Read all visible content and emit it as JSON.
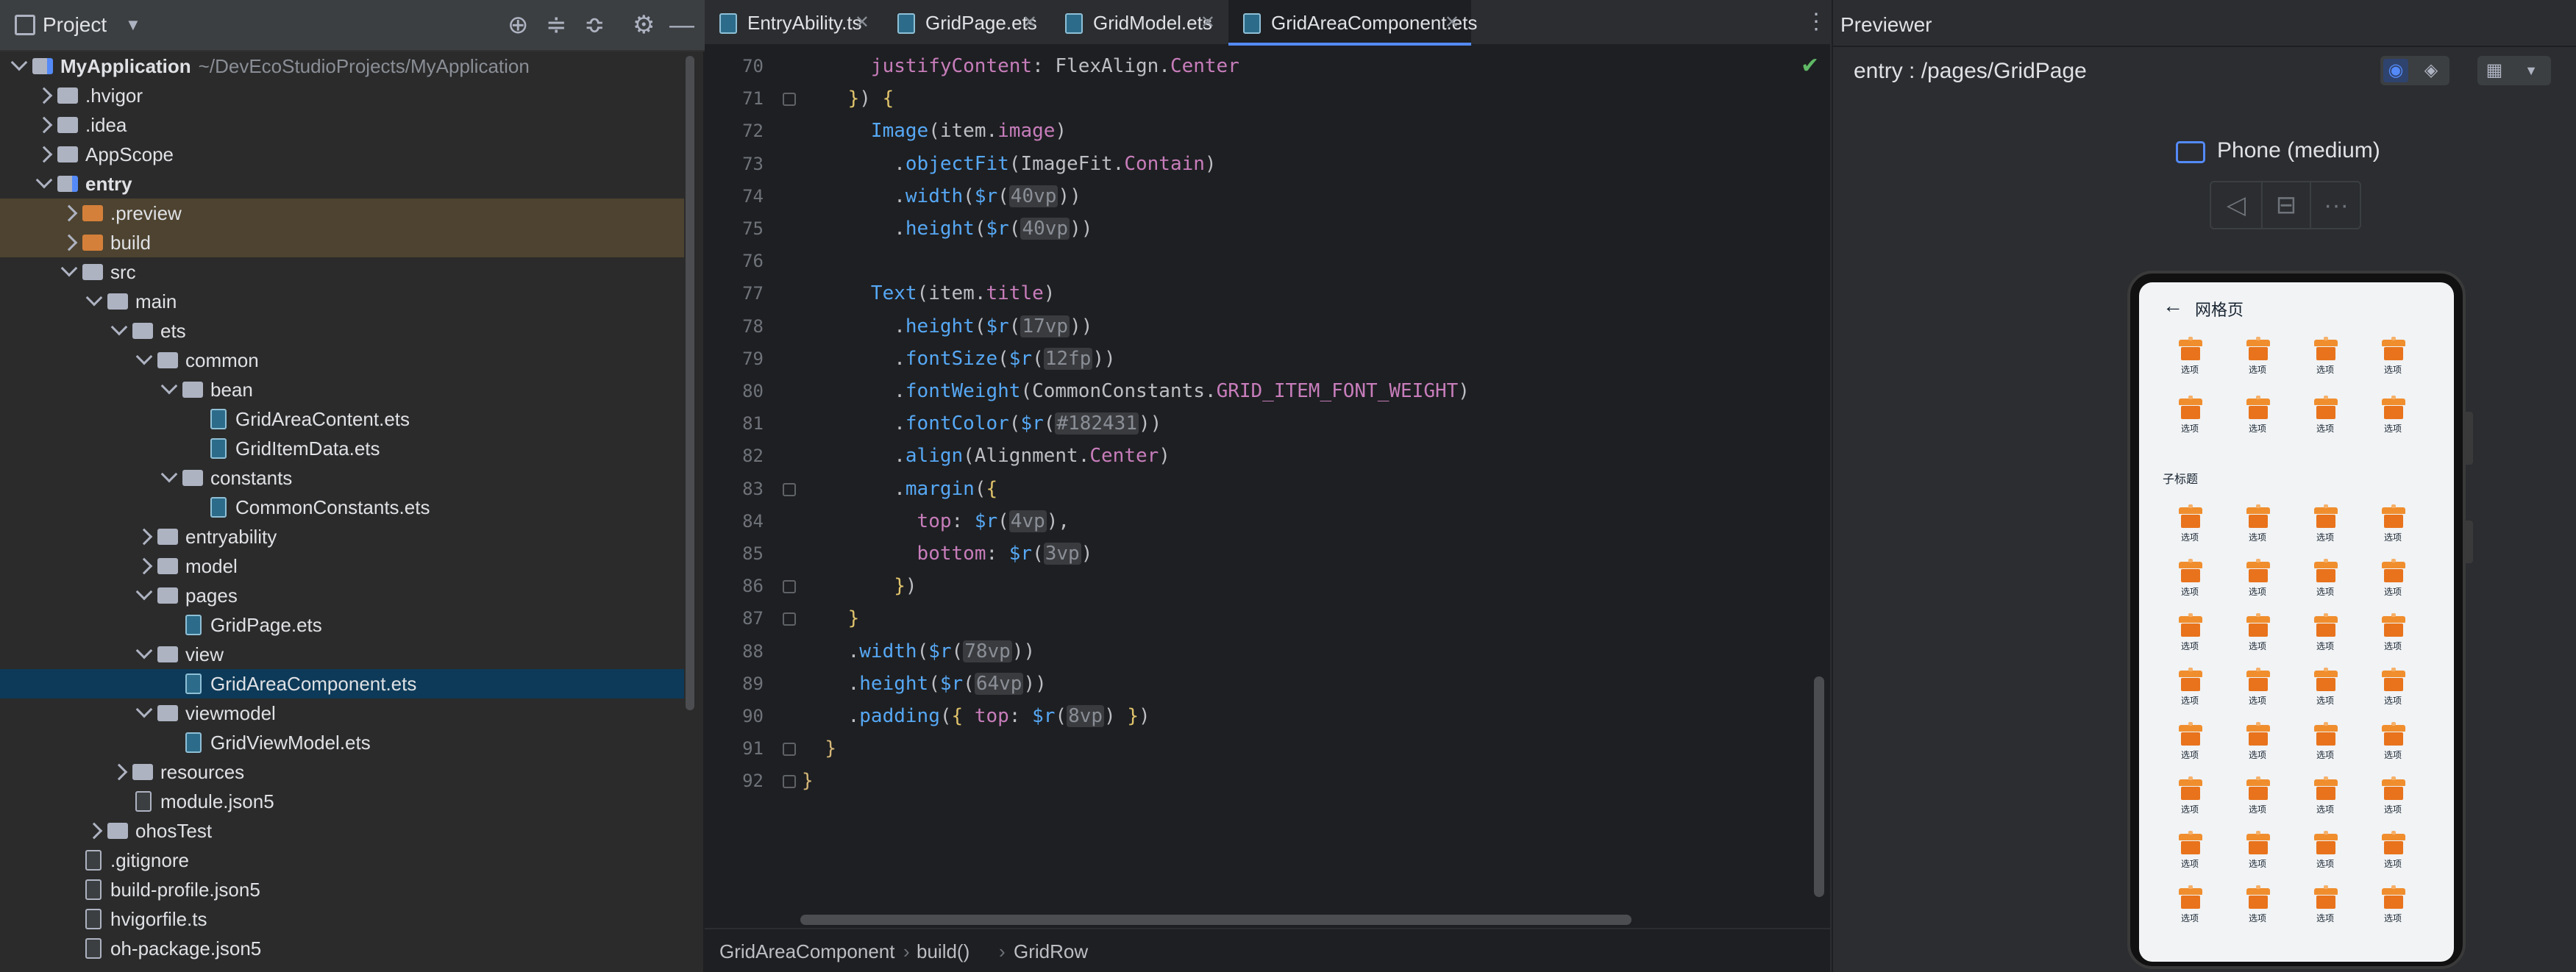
{
  "project_pane": {
    "title": "Project",
    "icons": [
      "dropdown-icon",
      "locate-icon",
      "expand-all-icon",
      "collapse-all-icon",
      "settings-icon",
      "hide-icon"
    ],
    "tree": [
      {
        "label": "MyApplication",
        "path": "~/DevEcoStudioProjects/MyApplication",
        "depth": 0,
        "state": "open",
        "icon": "module",
        "bold": true
      },
      {
        "label": ".hvigor",
        "depth": 1,
        "state": "closed",
        "icon": "folder"
      },
      {
        "label": ".idea",
        "depth": 1,
        "state": "closed",
        "icon": "folder"
      },
      {
        "label": "AppScope",
        "depth": 1,
        "state": "closed",
        "icon": "folder"
      },
      {
        "label": "entry",
        "depth": 1,
        "state": "open",
        "icon": "module",
        "bold": true
      },
      {
        "label": ".preview",
        "depth": 2,
        "state": "closed",
        "icon": "orange",
        "excluded": true
      },
      {
        "label": "build",
        "depth": 2,
        "state": "closed",
        "icon": "orange",
        "excluded": true
      },
      {
        "label": "src",
        "depth": 2,
        "state": "open",
        "icon": "folder"
      },
      {
        "label": "main",
        "depth": 3,
        "state": "open",
        "icon": "folder"
      },
      {
        "label": "ets",
        "depth": 4,
        "state": "open",
        "icon": "folder"
      },
      {
        "label": "common",
        "depth": 5,
        "state": "open",
        "icon": "folder"
      },
      {
        "label": "bean",
        "depth": 6,
        "state": "open",
        "icon": "folder"
      },
      {
        "label": "GridAreaContent.ets",
        "depth": 7,
        "state": "none",
        "icon": "ets"
      },
      {
        "label": "GridItemData.ets",
        "depth": 7,
        "state": "none",
        "icon": "ets"
      },
      {
        "label": "constants",
        "depth": 6,
        "state": "open",
        "icon": "folder"
      },
      {
        "label": "CommonConstants.ets",
        "depth": 7,
        "state": "none",
        "icon": "ets"
      },
      {
        "label": "entryability",
        "depth": 5,
        "state": "closed",
        "icon": "folder"
      },
      {
        "label": "model",
        "depth": 5,
        "state": "closed",
        "icon": "folder"
      },
      {
        "label": "pages",
        "depth": 5,
        "state": "open",
        "icon": "folder"
      },
      {
        "label": "GridPage.ets",
        "depth": 6,
        "state": "none",
        "icon": "ets"
      },
      {
        "label": "view",
        "depth": 5,
        "state": "open",
        "icon": "folder"
      },
      {
        "label": "GridAreaComponent.ets",
        "depth": 6,
        "state": "none",
        "icon": "ets",
        "selected": true
      },
      {
        "label": "viewmodel",
        "depth": 5,
        "state": "open",
        "icon": "folder"
      },
      {
        "label": "GridViewModel.ets",
        "depth": 6,
        "state": "none",
        "icon": "ets"
      },
      {
        "label": "resources",
        "depth": 4,
        "state": "closed",
        "icon": "folder"
      },
      {
        "label": "module.json5",
        "depth": 4,
        "state": "none",
        "icon": "file"
      },
      {
        "label": "ohosTest",
        "depth": 3,
        "state": "closed",
        "icon": "folder"
      },
      {
        "label": ".gitignore",
        "depth": 2,
        "state": "none",
        "icon": "file"
      },
      {
        "label": "build-profile.json5",
        "depth": 2,
        "state": "none",
        "icon": "file"
      },
      {
        "label": "hvigorfile.ts",
        "depth": 2,
        "state": "none",
        "icon": "file"
      },
      {
        "label": "oh-package.json5",
        "depth": 2,
        "state": "none",
        "icon": "file"
      }
    ]
  },
  "editor": {
    "tabs": [
      {
        "label": "EntryAbility.ts",
        "active": false
      },
      {
        "label": "GridPage.ets",
        "active": false
      },
      {
        "label": "GridModel.ets",
        "active": false
      },
      {
        "label": "GridAreaComponent.ets",
        "active": true
      }
    ],
    "lines": [
      {
        "n": "70",
        "fold": false,
        "html": "      <span class='prop'>justifyContent</span>: <span class='type'>FlexAlign</span>.<span class='prop'>Center</span>"
      },
      {
        "n": "71",
        "fold": true,
        "html": "    <span class='br'>}</span>) <span class='br'>{</span>"
      },
      {
        "n": "72",
        "fold": false,
        "html": "      <span class='fn'>Image</span>(<span class='id'>item</span>.<span class='prop'>image</span>)"
      },
      {
        "n": "73",
        "fold": false,
        "html": "        .<span class='fn'>objectFit</span>(<span class='type'>ImageFit</span>.<span class='prop'>Contain</span>)"
      },
      {
        "n": "74",
        "fold": false,
        "html": "        .<span class='fn'>width</span>(<span class='fn'>$r</span>(<span class='num'>40vp</span>))"
      },
      {
        "n": "75",
        "fold": false,
        "html": "        .<span class='fn'>height</span>(<span class='fn'>$r</span>(<span class='num'>40vp</span>))"
      },
      {
        "n": "76",
        "fold": false,
        "html": ""
      },
      {
        "n": "77",
        "fold": false,
        "html": "      <span class='fn'>Text</span>(<span class='id'>item</span>.<span class='prop'>title</span>)"
      },
      {
        "n": "78",
        "fold": false,
        "html": "        .<span class='fn'>height</span>(<span class='fn'>$r</span>(<span class='num'>17vp</span>))"
      },
      {
        "n": "79",
        "fold": false,
        "html": "        .<span class='fn'>fontSize</span>(<span class='fn'>$r</span>(<span class='num'>12fp</span>))"
      },
      {
        "n": "80",
        "fold": false,
        "html": "        .<span class='fn'>fontWeight</span>(<span class='type'>CommonConstants</span>.<span class='prop'>GRID_ITEM_FONT_WEIGHT</span>)"
      },
      {
        "n": "81",
        "fold": false,
        "html": "        .<span class='fn'>fontColor</span>(<span class='fn'>$r</span>(<span class='num'>#182431</span>))"
      },
      {
        "n": "82",
        "fold": false,
        "html": "        .<span class='fn'>align</span>(<span class='type'>Alignment</span>.<span class='prop'>Center</span>)"
      },
      {
        "n": "83",
        "fold": true,
        "html": "        .<span class='fn'>margin</span>(<span class='br'>{</span>"
      },
      {
        "n": "84",
        "fold": false,
        "html": "          <span class='prop'>top</span>: <span class='fn'>$r</span>(<span class='num'>4vp</span>),"
      },
      {
        "n": "85",
        "fold": false,
        "html": "          <span class='prop'>bottom</span>: <span class='fn'>$r</span>(<span class='num'>3vp</span>)"
      },
      {
        "n": "86",
        "fold": true,
        "html": "        <span class='br'>}</span>)"
      },
      {
        "n": "87",
        "fold": true,
        "html": "    <span class='br'>}</span>"
      },
      {
        "n": "88",
        "fold": false,
        "html": "    .<span class='fn'>width</span>(<span class='fn'>$r</span>(<span class='num'>78vp</span>))"
      },
      {
        "n": "89",
        "fold": false,
        "html": "    .<span class='fn'>height</span>(<span class='fn'>$r</span>(<span class='num'>64vp</span>))"
      },
      {
        "n": "90",
        "fold": false,
        "html": "    .<span class='fn'>padding</span>(<span class='br'>{</span> <span class='prop'>top</span>: <span class='fn'>$r</span>(<span class='num'>8vp</span>) <span class='br'>}</span>)"
      },
      {
        "n": "91",
        "fold": true,
        "html": "  <span class='br2'>}</span>"
      },
      {
        "n": "92",
        "fold": true,
        "html": "<span class='br2'>}</span>"
      }
    ],
    "breadcrumbs": [
      "GridAreaComponent",
      "build()",
      "GridRow"
    ]
  },
  "previewer": {
    "title": "Previewer",
    "route": "entry : /pages/GridPage",
    "device": "Phone (medium)",
    "controls": [
      "back-icon",
      "rotate-icon",
      "more-icon"
    ],
    "screen": {
      "title": "网格页",
      "back": "←",
      "subtitle": "子标题",
      "item_label": "选项",
      "top_grid": {
        "rows": 2,
        "cols": 4
      },
      "bottom_grid": {
        "rows": 8,
        "cols": 4
      }
    }
  },
  "colors": {
    "accent": "#548af7",
    "excluded_row": "#4d4330",
    "selected_row": "#0d3a58",
    "grid_icon": "#e8731c"
  }
}
